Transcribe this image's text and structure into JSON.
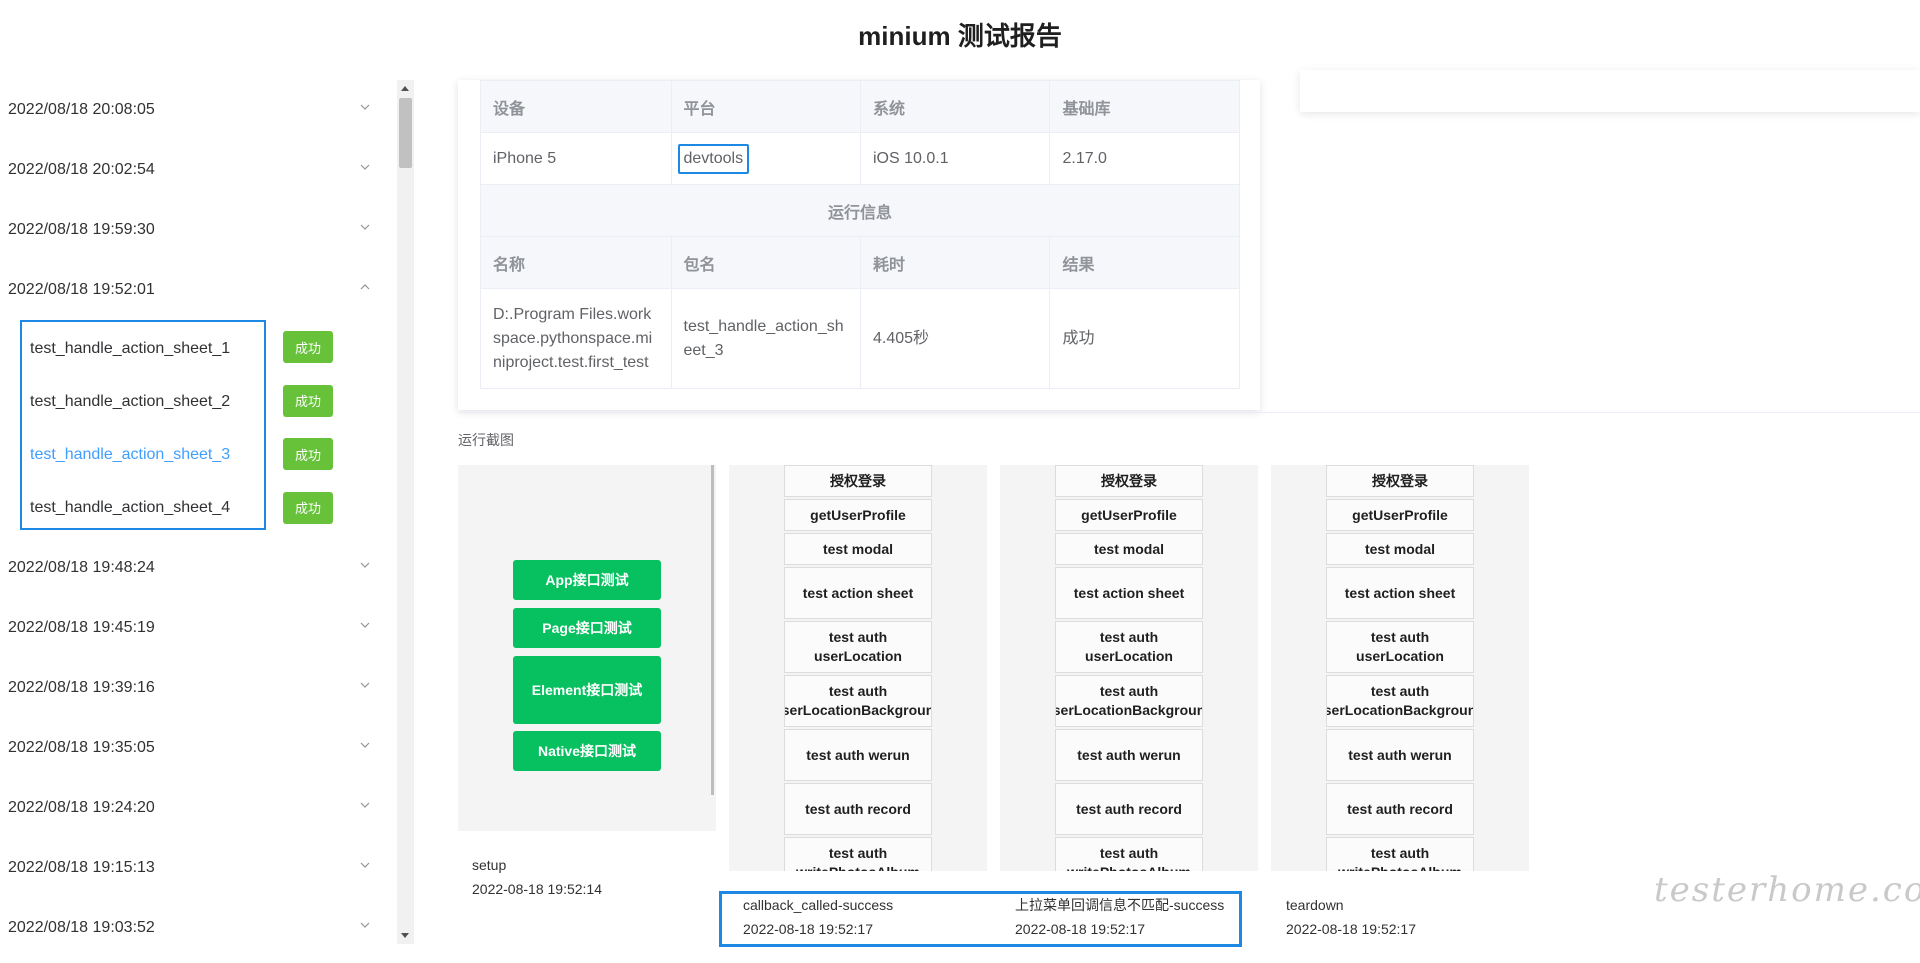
{
  "title": "minium 测试报告",
  "sidebar": {
    "runs_before": [
      "2022/08/18 20:08:05",
      "2022/08/18 20:02:54",
      "2022/08/18 19:59:30",
      "2022/08/18 19:52:01"
    ],
    "cases": [
      {
        "name": "test_handle_action_sheet_1",
        "status": "成功"
      },
      {
        "name": "test_handle_action_sheet_2",
        "status": "成功"
      },
      {
        "name": "test_handle_action_sheet_3",
        "status": "成功"
      },
      {
        "name": "test_handle_action_sheet_4",
        "status": "成功"
      }
    ],
    "runs_after": [
      "2022/08/18 19:48:24",
      "2022/08/18 19:45:19",
      "2022/08/18 19:39:16",
      "2022/08/18 19:35:05",
      "2022/08/18 19:24:20",
      "2022/08/18 19:15:13",
      "2022/08/18 19:03:52"
    ]
  },
  "device_table": {
    "headers": [
      "设备",
      "平台",
      "系统",
      "基础库"
    ],
    "values": [
      "iPhone 5",
      "devtools",
      "iOS 10.0.1",
      "2.17.0"
    ],
    "section_title": "运行信息",
    "run_headers": [
      "名称",
      "包名",
      "耗时",
      "结果"
    ],
    "run_values": [
      "D:.Program Files.workspace.pythonspace.miniproject.test.first_test",
      "test_handle_action_sheet_3",
      "4.405秒",
      "成功"
    ]
  },
  "screenshots": {
    "label": "运行截图",
    "first_buttons": [
      "App接口测试",
      "Page接口测试",
      "Element接口测试",
      "Native接口测试"
    ],
    "menu_items": [
      "授权登录",
      "getUserProfile",
      "test modal",
      "test action sheet",
      "test auth userLocation",
      "test auth userLocationBackground",
      "test auth werun",
      "test auth record",
      "test auth writePhotosAlbum"
    ]
  },
  "steps": [
    {
      "name": "setup",
      "time": "2022-08-18 19:52:14"
    },
    {
      "name": "callback_called-success",
      "time": "2022-08-18 19:52:17"
    },
    {
      "name": "上拉菜单回调信息不匹配-success",
      "time": "2022-08-18 19:52:17"
    },
    {
      "name": "teardown",
      "time": "2022-08-18 19:52:17"
    }
  ],
  "watermark": "testerhome.com"
}
